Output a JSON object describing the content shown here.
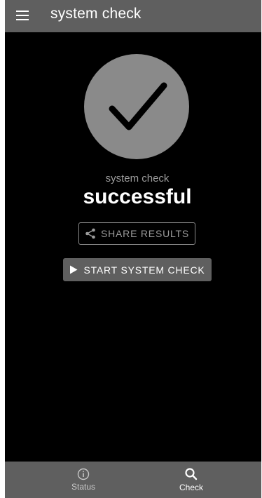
{
  "app_bar": {
    "title": "system check",
    "menu_icon": "hamburger-menu-icon"
  },
  "status": {
    "icon": "checkmark-icon",
    "caption": "system check",
    "result": "successful"
  },
  "actions": {
    "share_label": "SHARE RESULTS",
    "share_icon": "share-icon",
    "start_label": "START SYSTEM CHECK",
    "start_icon": "play-icon"
  },
  "bottom_nav": {
    "items": [
      {
        "label": "Status",
        "icon": "info-icon",
        "active": false
      },
      {
        "label": "Check",
        "icon": "search-icon",
        "active": true
      }
    ]
  },
  "colors": {
    "app_bar": "#5f5f5f",
    "background": "#000000",
    "circle": "#8a8a8a",
    "accent_text": "#ffffff",
    "muted_text": "#9c9c9c"
  }
}
